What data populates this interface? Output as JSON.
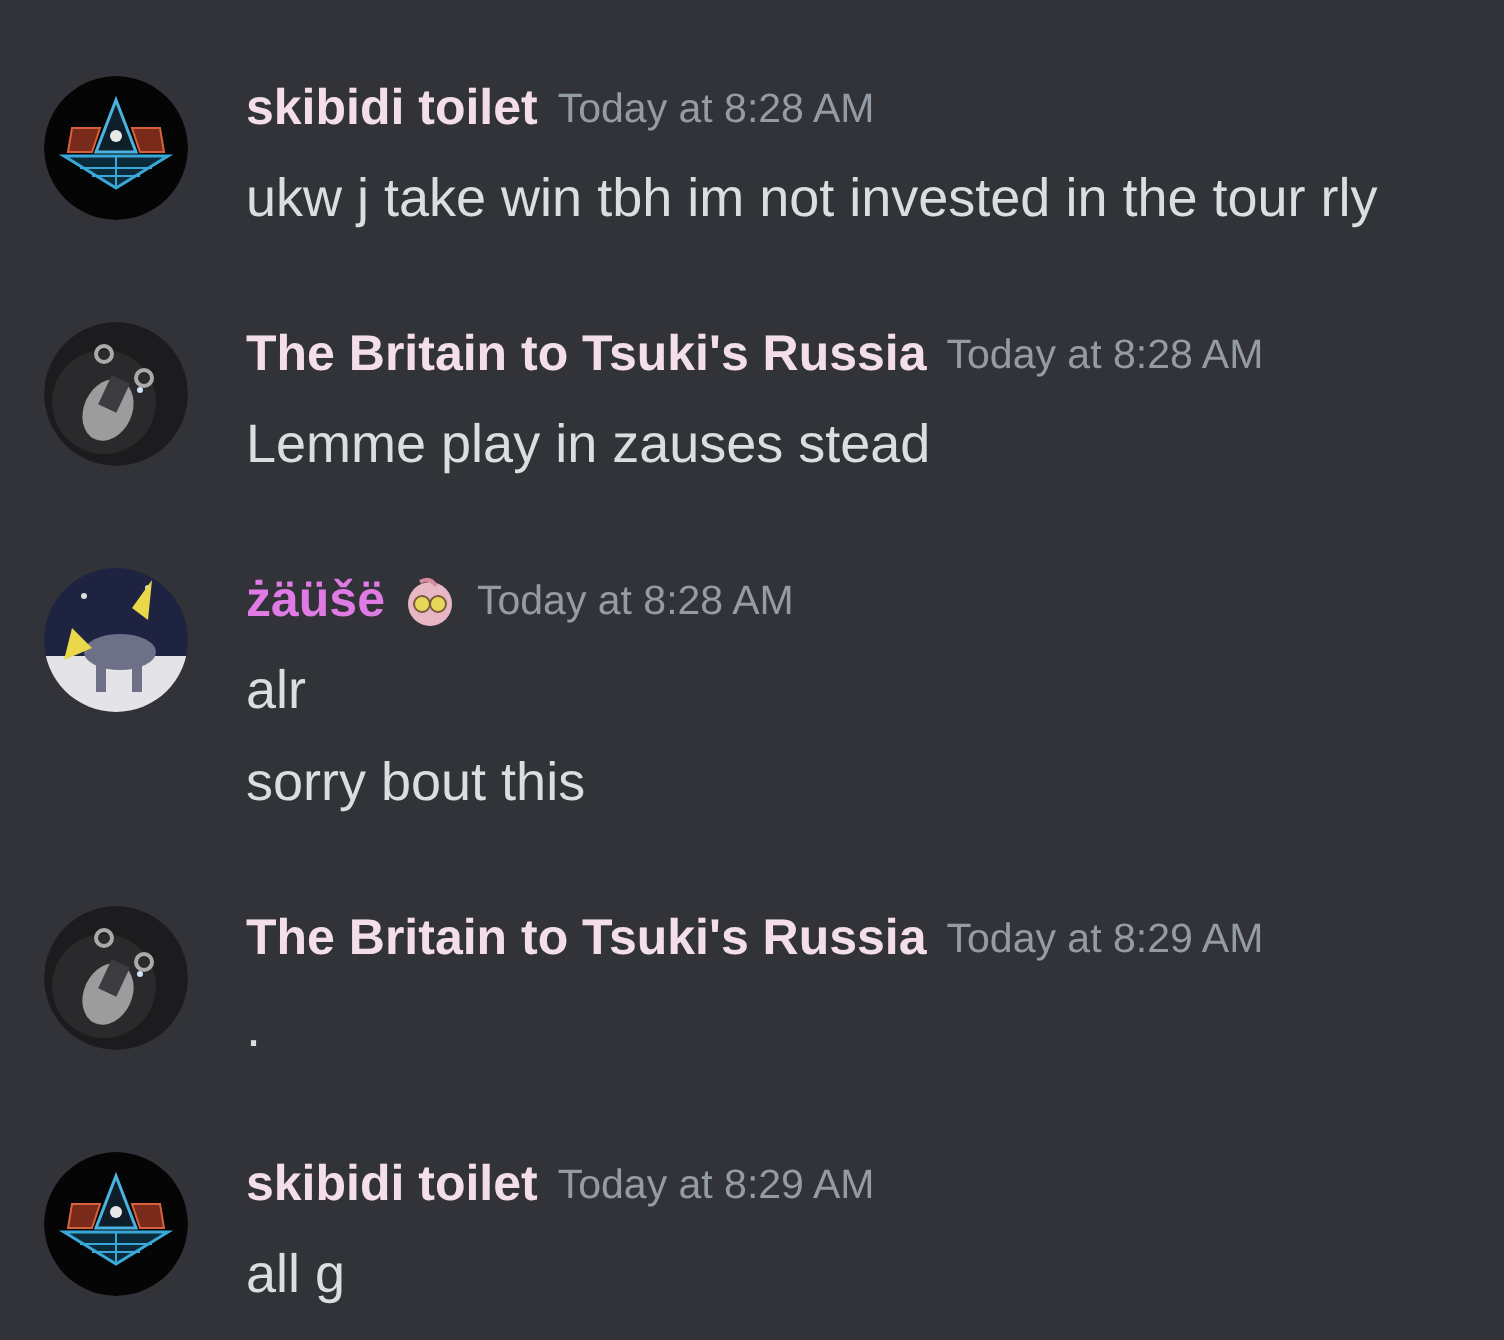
{
  "messages": [
    {
      "avatar": {
        "kind": "pyramid"
      },
      "author": "skibidi toilet",
      "color": "#f4dfe8",
      "role_icon": false,
      "timestamp": "Today at 8:28 AM",
      "lines": [
        "ukw j take win tbh im not invested in the tour rly"
      ]
    },
    {
      "avatar": {
        "kind": "lyre"
      },
      "author": "The Britain to Tsuki's Russia",
      "color": "#f4dfe8",
      "role_icon": false,
      "timestamp": "Today at 8:28 AM",
      "lines": [
        "Lemme play in zauses stead"
      ]
    },
    {
      "avatar": {
        "kind": "creature"
      },
      "author": "żäüšë",
      "color": "#e07be6",
      "role_icon": true,
      "timestamp": "Today at 8:28 AM",
      "lines": [
        "alr",
        "sorry bout this"
      ]
    },
    {
      "avatar": {
        "kind": "lyre"
      },
      "author": "The Britain to Tsuki's Russia",
      "color": "#f4dfe8",
      "role_icon": false,
      "timestamp": "Today at 8:29 AM",
      "lines": [
        "."
      ]
    },
    {
      "avatar": {
        "kind": "pyramid"
      },
      "author": "skibidi toilet",
      "color": "#f4dfe8",
      "role_icon": false,
      "timestamp": "Today at 8:29 AM",
      "lines": [
        "all g"
      ]
    }
  ]
}
